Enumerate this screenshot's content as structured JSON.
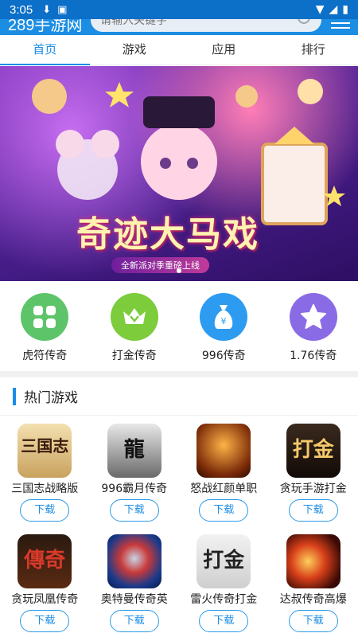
{
  "status_bar": {
    "time": "3:05"
  },
  "header": {
    "logo": "289手游网",
    "search_placeholder": "请输入关键字"
  },
  "tabs": [
    {
      "label": "首页",
      "active": true
    },
    {
      "label": "游戏",
      "active": false
    },
    {
      "label": "应用",
      "active": false
    },
    {
      "label": "排行",
      "active": false
    }
  ],
  "banner": {
    "title": "奇迹大马戏",
    "subtitle": "全新派对季重磅上线",
    "slide_count": 1,
    "active_slide": 1
  },
  "categories": [
    {
      "label": "虎符传奇",
      "color": "#5ec46a",
      "icon": "grid-icon"
    },
    {
      "label": "打金传奇",
      "color": "#7ccc3c",
      "icon": "crown-icon"
    },
    {
      "label": "996传奇",
      "color": "#2d9cf0",
      "icon": "money-bag-icon"
    },
    {
      "label": "1.76传奇",
      "color": "#8a6be6",
      "icon": "star-icon"
    }
  ],
  "section": {
    "title": "热门游戏"
  },
  "games": [
    {
      "name": "三国志战略版",
      "download": "下载",
      "icon_text": "三国志"
    },
    {
      "name": "996霸月传奇",
      "download": "下载",
      "icon_text": "龍"
    },
    {
      "name": "怒战红颜单职",
      "download": "下载",
      "icon_text": ""
    },
    {
      "name": "贪玩手游打金",
      "download": "下载",
      "icon_text": "打金"
    },
    {
      "name": "贪玩凤凰传奇",
      "download": "下载",
      "icon_text": "傳奇"
    },
    {
      "name": "奥特曼传奇英",
      "download": "下载",
      "icon_text": ""
    },
    {
      "name": "雷火传奇打金",
      "download": "下载",
      "icon_text": "打金"
    },
    {
      "name": "达叔传奇高爆",
      "download": "下载",
      "icon_text": ""
    }
  ],
  "colors": {
    "accent": "#1a8ce6",
    "status_bar": "#0c6fc8"
  }
}
